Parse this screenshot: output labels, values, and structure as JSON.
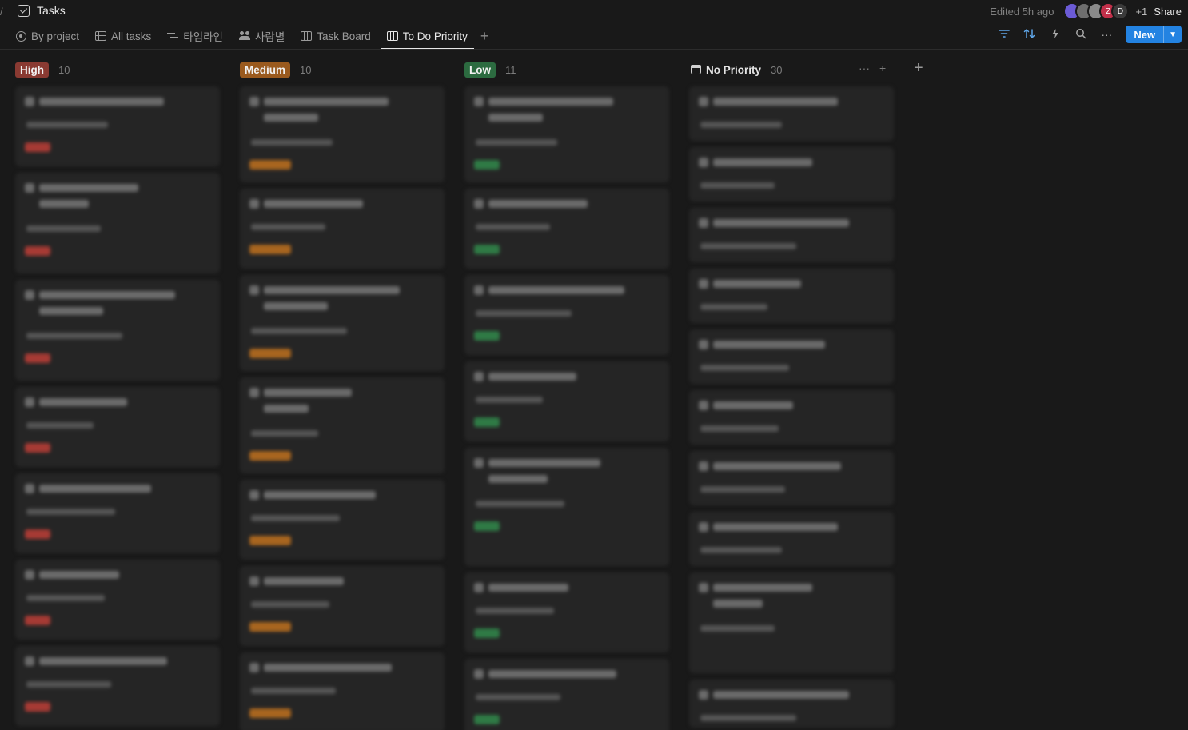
{
  "header": {
    "breadcrumb_sep": "/",
    "title": "Tasks",
    "edited": "Edited 5h ago",
    "avatars": [
      {
        "initial": "",
        "color": "#6b5bd6"
      },
      {
        "initial": "",
        "color": "#6e6e6e"
      },
      {
        "initial": "",
        "color": "#8a8a8a"
      },
      {
        "initial": "Z",
        "color": "#c2304a"
      },
      {
        "initial": "D",
        "color": "#3a3a3a"
      }
    ],
    "extra_count": "+1",
    "share_label": "Share"
  },
  "tabs": [
    {
      "label": "By project",
      "icon": "target-icon"
    },
    {
      "label": "All tasks",
      "icon": "table-icon"
    },
    {
      "label": "타임라인",
      "icon": "timeline-icon"
    },
    {
      "label": "사람별",
      "icon": "people-icon"
    },
    {
      "label": "Task Board",
      "icon": "board-icon"
    },
    {
      "label": "To Do Priority",
      "icon": "board-icon",
      "active": true
    }
  ],
  "toolbar": {
    "new_label": "New"
  },
  "columns": [
    {
      "label": "High",
      "count": "10",
      "badge_color": "#8a3a32",
      "tag_color": "#a63a34",
      "card_heights": [
        100,
        126,
        126,
        100,
        100,
        100,
        100
      ]
    },
    {
      "label": "Medium",
      "count": "10",
      "badge_color": "#9a5a1e",
      "tag_color": "#a8651f",
      "card_heights": [
        120,
        100,
        120,
        120,
        100,
        100,
        100
      ]
    },
    {
      "label": "Low",
      "count": "11",
      "badge_color": "#2c6b40",
      "tag_color": "#2f7a45",
      "card_heights": [
        120,
        100,
        100,
        100,
        148,
        100,
        100
      ]
    },
    {
      "label": "No Priority",
      "count": "30",
      "badge_color": "",
      "tag_color": "",
      "card_heights": [
        68,
        68,
        68,
        68,
        68,
        68,
        68,
        68,
        126,
        60
      ]
    }
  ]
}
